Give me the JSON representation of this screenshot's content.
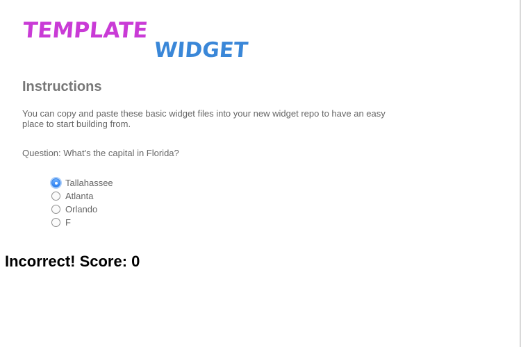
{
  "logo": {
    "word1": "TEMPLATE",
    "word2": "WIDGET",
    "word1_color": "#c93bd6",
    "word2_color": "#3a87d8"
  },
  "instructions": {
    "title": "Instructions",
    "text": "You can copy and paste these basic widget files into your new widget repo to have an easy place to start building from."
  },
  "quiz": {
    "question": "Question: What's the capital in Florida?",
    "options": [
      {
        "label": "Tallahassee",
        "selected": true
      },
      {
        "label": "Atlanta",
        "selected": false
      },
      {
        "label": "Orlando",
        "selected": false
      },
      {
        "label": "F",
        "selected": false
      }
    ],
    "result": "Incorrect! Score: 0"
  }
}
